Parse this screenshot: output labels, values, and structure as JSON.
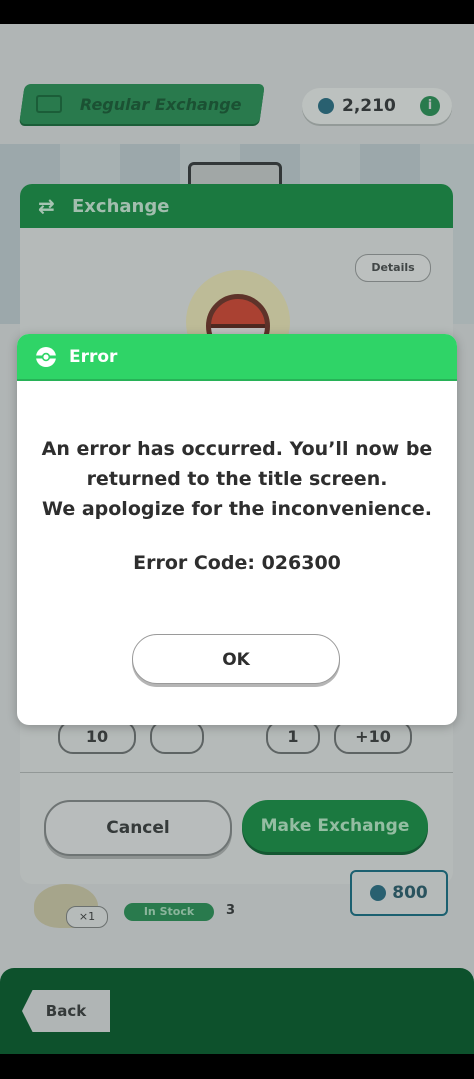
{
  "header": {
    "exchange_type": "Regular Exchange",
    "coins": "2,210",
    "info_icon": "info-icon"
  },
  "panel": {
    "title": "Exchange",
    "details_label": "Details",
    "stepper_values": [
      "10",
      "",
      "1",
      "+10"
    ],
    "cancel_label": "Cancel",
    "make_exchange_label": "Make Exchange"
  },
  "item_row": {
    "qty": "×1",
    "stock_label": "In Stock",
    "stock_count": "3",
    "price": "800"
  },
  "footer": {
    "back_label": "Back"
  },
  "dialog": {
    "title": "Error",
    "line1": "An error has occurred. You’ll now be",
    "line2": "returned to the title screen.",
    "line3": "We apologize for the inconvenience.",
    "error_code": "Error Code: 026300",
    "ok_label": "OK"
  },
  "colors": {
    "dialog_header": "#2fd467",
    "app_green": "#1f8a49"
  }
}
